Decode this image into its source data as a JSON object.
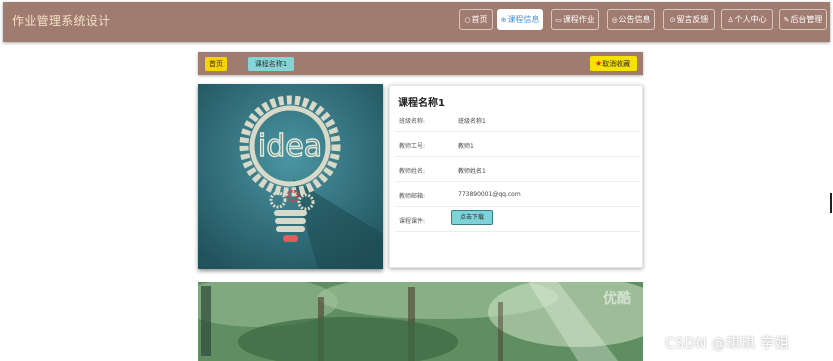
{
  "site": {
    "title": "作业管理系统设计"
  },
  "nav": [
    {
      "icon": "○",
      "label": "首页",
      "active": false
    },
    {
      "icon": "⊕",
      "label": "课程信息",
      "active": true
    },
    {
      "icon": "▭",
      "label": "课程作业",
      "active": false
    },
    {
      "icon": "◎",
      "label": "公告信息",
      "active": false
    },
    {
      "icon": "⊙",
      "label": "留言反馈",
      "active": false
    },
    {
      "icon": "♙",
      "label": "个人中心",
      "active": false
    },
    {
      "icon": "✎",
      "label": "后台管理",
      "active": false
    }
  ],
  "breadcrumb": {
    "home": "首页",
    "current": "课程名称1"
  },
  "favorite": {
    "label": "取消收藏",
    "star": "★"
  },
  "image": {
    "word": "idea"
  },
  "detail": {
    "title": "课程名称1",
    "rows": [
      {
        "label": "班级名称:",
        "value": "班级名称1"
      },
      {
        "label": "教师工号:",
        "value": "教师1"
      },
      {
        "label": "教师姓名:",
        "value": "教师姓名1"
      },
      {
        "label": "教师邮箱:",
        "value": "773890001@qq.com"
      }
    ],
    "courseware_label": "课程课件:",
    "download_label": "点击下载"
  },
  "video": {
    "logo": "优酷"
  },
  "watermark": "CSDN @琪琪 学姐",
  "colors": {
    "header": "#a07c70",
    "home_badge": "#f5d400",
    "course_badge": "#86d4d6",
    "fav": "#f5e200"
  }
}
